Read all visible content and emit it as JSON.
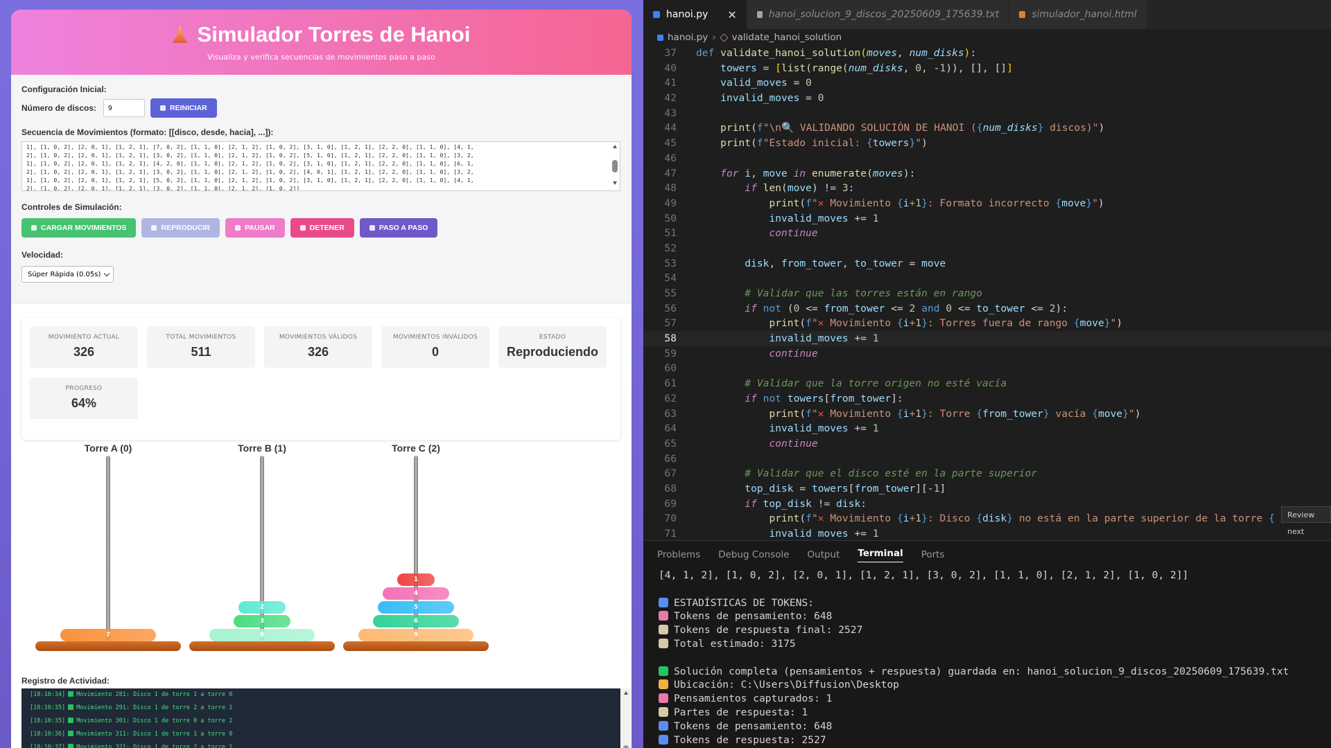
{
  "sim": {
    "title": "Simulador Torres de Hanoi",
    "subtitle": "Visualiza y verifica secuencias de movimientos paso a paso",
    "config_label": "Configuración Inicial:",
    "disks_label": "Número de discos:",
    "disks_value": "9",
    "reset_label": "REINICIAR",
    "sequence_label": "Secuencia de Movimientos (formato: [[disco, desde, hacia], ...]):",
    "sequence_text": "1], [1, 0, 2], [2, 0, 1], [1, 2, 1], [7, 0, 2], [1, 1, 0], [2, 1, 2], [1, 0, 2], [3, 1, 0], [1, 2, 1], [2, 2, 0], [1, 1, 0], [4, 1,\n2], [1, 0, 2], [2, 0, 1], [1, 2, 1], [3, 0, 2], [1, 1, 0], [2, 1, 2], [1, 0, 2], [5, 1, 0], [1, 2, 1], [2, 2, 0], [1, 1, 0], [3, 2,\n1], [1, 0, 2], [2, 0, 1], [1, 2, 1], [4, 2, 0], [1, 1, 0], [2, 1, 2], [1, 0, 2], [3, 1, 0], [1, 2, 1], [2, 2, 0], [1, 1, 0], [6, 1,\n2], [1, 0, 2], [2, 0, 1], [1, 2, 1], [3, 0, 2], [1, 1, 0], [2, 1, 2], [1, 0, 2], [4, 0, 1], [1, 2, 1], [2, 2, 0], [1, 1, 0], [3, 2,\n1], [1, 0, 2], [2, 0, 1], [1, 2, 1], [5, 0, 2], [1, 1, 0], [2, 1, 2], [1, 0, 2], [3, 1, 0], [1, 2, 1], [2, 2, 0], [1, 1, 0], [4, 1,\n2], [1, 0, 2], [2, 0, 1], [1, 2, 1], [3, 0, 2], [1, 1, 0], [2, 1, 2], [1, 0, 2]]",
    "controls_label": "Controles de Simulación:",
    "buttons": {
      "load": "CARGAR MOVIMIENTOS",
      "play": "REPRODUCIR",
      "pause": "PAUSAR",
      "stop": "DETENER",
      "step": "PASO A PASO"
    },
    "speed_label": "Velocidad:",
    "speed_value": "Súper Rápida (0.05s)",
    "stats": {
      "current_label": "MOVIMIENTO ACTUAL",
      "current": "326",
      "total_label": "TOTAL MOVIMIENTOS",
      "total": "511",
      "valid_label": "MOVIMIENTOS VÁLIDOS",
      "valid": "326",
      "invalid_label": "MOVIMIENTOS INVÁLIDOS",
      "invalid": "0",
      "state_label": "ESTADO",
      "state": "Reproduciendo",
      "progress_label": "PROGRESO",
      "progress": "64%"
    },
    "towers": [
      {
        "title": "Torre A (0)",
        "disks": [
          7
        ]
      },
      {
        "title": "Torre B (1)",
        "disks": [
          8,
          3,
          2
        ]
      },
      {
        "title": "Torre C (2)",
        "disks": [
          9,
          6,
          5,
          4,
          1
        ]
      }
    ],
    "disk_colors": {
      "1": "#ef4444",
      "2": "#5eead4",
      "3": "#4ade80",
      "4": "#f472b6",
      "5": "#38bdf8",
      "6": "#34d399",
      "7": "#fb923c",
      "8": "#a7f3d0",
      "9": "#fdba74"
    },
    "log_label": "Registro de Actividad:",
    "log": [
      "[18:10:34] Movimiento 281: Disco 1 de torre 1 a torre 0",
      "[18:10:35] Movimiento 291: Disco 1 de torre 2 a torre 1",
      "[18:10:35] Movimiento 301: Disco 1 de torre 0 a torre 2",
      "[18:10:36] Movimiento 311: Disco 1 de torre 1 a torre 0",
      "[18:10:37] Movimiento 321: Disco 1 de torre 2 a torre 1"
    ]
  },
  "editor": {
    "tabs": [
      {
        "label": "hanoi.py",
        "active": true
      },
      {
        "label": "hanoi_solucion_9_discos_20250609_175639.txt",
        "active": false
      },
      {
        "label": "simulador_hanoi.html",
        "active": false
      }
    ],
    "breadcrumb_file": "hanoi.py",
    "breadcrumb_symbol": "validate_hanoi_solution",
    "review_label": "Review next",
    "current_line": 58
  },
  "panel": {
    "tabs": [
      "Problems",
      "Debug Console",
      "Output",
      "Terminal",
      "Ports"
    ],
    "active_tab": "Terminal",
    "terminal": [
      {
        "icon": "",
        "text": "[4, 1, 2], [1, 0, 2], [2, 0, 1], [1, 2, 1], [3, 0, 2], [1, 1, 0], [2, 1, 2], [1, 0, 2]]"
      },
      {
        "icon": "",
        "text": ""
      },
      {
        "icon": "chart-icon",
        "text": "ESTADÍSTICAS DE TOKENS:"
      },
      {
        "icon": "brain-icon",
        "text": "Tokens de pensamiento: 648"
      },
      {
        "icon": "memo-icon",
        "text": "Tokens de respuesta final: 2527"
      },
      {
        "icon": "memo-icon",
        "text": "Total estimado: 3175"
      },
      {
        "icon": "",
        "text": ""
      },
      {
        "icon": "check-icon",
        "text": "Solución completa (pensamientos + respuesta) guardada en: hanoi_solucion_9_discos_20250609_175639.txt"
      },
      {
        "icon": "folder-icon",
        "text": "Ubicación: C:\\Users\\Diffusion\\Desktop"
      },
      {
        "icon": "brain-icon",
        "text": "Pensamientos capturados: 1"
      },
      {
        "icon": "memo-icon",
        "text": "Partes de respuesta: 1"
      },
      {
        "icon": "chart-icon",
        "text": "Tokens de pensamiento: 648"
      },
      {
        "icon": "chart-icon",
        "text": "Tokens de respuesta: 2527"
      }
    ]
  }
}
